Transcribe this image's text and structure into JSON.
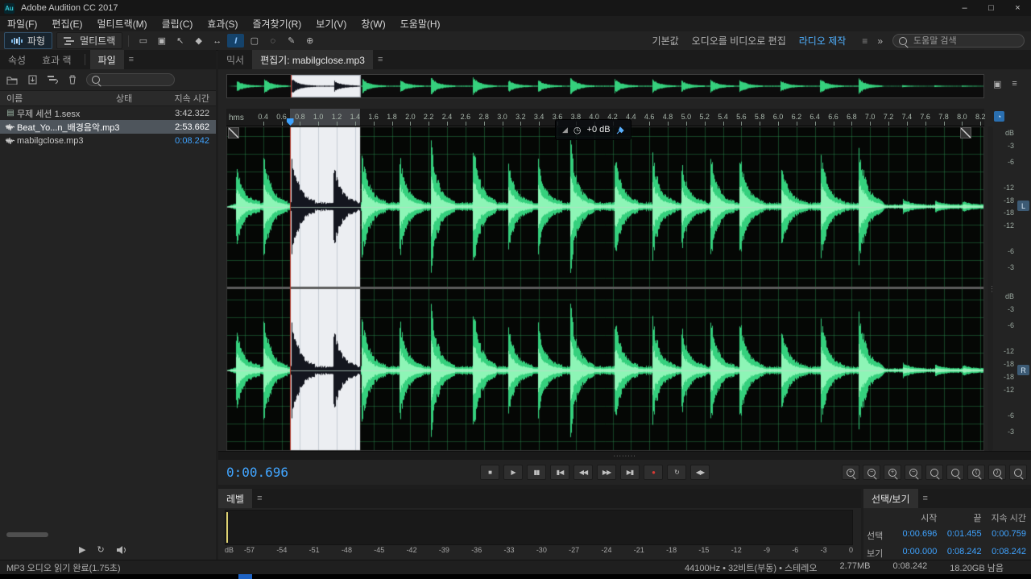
{
  "window": {
    "title": "Adobe Audition CC 2017",
    "icon_text": "Au",
    "minimize_glyph": "–",
    "maximize_glyph": "□",
    "close_glyph": "×"
  },
  "menu_bar": {
    "items": [
      "파일(F)",
      "편집(E)",
      "멀티트랙(M)",
      "클립(C)",
      "효과(S)",
      "즐겨찾기(R)",
      "보기(V)",
      "창(W)",
      "도움말(H)"
    ]
  },
  "toolbar": {
    "view_buttons": [
      {
        "name": "waveform-view-button",
        "label": "파형",
        "active": true
      },
      {
        "name": "multitrack-view-button",
        "label": "멀티트랙",
        "active": false
      }
    ],
    "tools": [
      {
        "name": "panel-layout-icon",
        "glyph": "▭",
        "active": false
      },
      {
        "name": "video-monitor-icon",
        "glyph": "▣",
        "active": false
      },
      {
        "name": "move-tool-icon",
        "glyph": "↖",
        "active": false
      },
      {
        "name": "razor-tool-icon",
        "glyph": "◆",
        "active": false
      },
      {
        "name": "slip-tool-icon",
        "glyph": "↔",
        "active": false
      },
      {
        "name": "time-selection-tool-icon",
        "glyph": "I",
        "active": true
      },
      {
        "name": "marquee-selection-tool-icon",
        "glyph": "▢",
        "active": false
      },
      {
        "name": "lasso-selection-tool-icon",
        "glyph": "◌",
        "active": false
      },
      {
        "name": "paintbrush-tool-icon",
        "glyph": "✎",
        "active": false
      },
      {
        "name": "spot-healing-brush-icon",
        "glyph": "⊕",
        "active": false
      }
    ],
    "workspaces": [
      {
        "label": "기본값",
        "active": false
      },
      {
        "label": "오디오를 비디오로 편집",
        "active": false
      },
      {
        "label": "라디오 제작",
        "active": true
      }
    ],
    "workspace_menu_glyph": "≡",
    "overflow_glyph": "»",
    "search": {
      "placeholder": "도움말 검색"
    }
  },
  "files_panel": {
    "tabs": [
      {
        "label": "속성",
        "active": false
      },
      {
        "label": "효과 랙",
        "active": false
      },
      {
        "label": "파일",
        "active": true
      }
    ],
    "panel_menu_glyph": "≡",
    "columns": [
      "이름",
      "상태",
      "지속 시간"
    ],
    "rows": [
      {
        "name": "무제 세션 1.sesx",
        "status": "",
        "duration": "3:42.322",
        "type": "session",
        "selected": false,
        "open": false
      },
      {
        "name": "Beat_Yo...n_배경음악.mp3",
        "status": "",
        "duration": "2:53.662",
        "type": "audio",
        "selected": true,
        "open": false
      },
      {
        "name": "mabilgclose.mp3",
        "status": "",
        "duration": "0:08.242",
        "type": "audio",
        "selected": false,
        "open": true
      }
    ]
  },
  "editor": {
    "tabs": [
      {
        "label": "믹서",
        "active": false
      },
      {
        "label": "편집기: mabilgclose.mp3",
        "active": true
      }
    ],
    "panel_menu_glyph": "≡",
    "timeline": {
      "unit": "hms",
      "ticks": [
        "0.4",
        "0.6",
        "0.8",
        "1.0",
        "1.2",
        "1.4",
        "1.6",
        "1.8",
        "2.0",
        "2.2",
        "2.4",
        "2.6",
        "2.8",
        "3.0",
        "3.2",
        "3.4",
        "3.6",
        "3.8",
        "4.0",
        "4.2",
        "4.4",
        "4.6",
        "4.8",
        "5.0",
        "5.2",
        "5.4",
        "5.6",
        "5.8",
        "6.0",
        "6.2",
        "6.4",
        "6.6",
        "6.8",
        "7.0",
        "7.2",
        "7.4",
        "7.6",
        "7.8",
        "8.0",
        "8.2"
      ],
      "view_start_seconds": 0,
      "view_end_seconds": 8.242
    },
    "selection": {
      "start_seconds": 0.696,
      "end_seconds": 1.455
    },
    "hud": {
      "gain_label": "+0 dB"
    },
    "amplitude_ruler": {
      "unit": "dB",
      "labels": [
        "-3",
        "-6",
        "-12",
        "-18"
      ]
    },
    "channel_buttons": [
      "L",
      "R"
    ],
    "colors": {
      "waveform": "#35d07d",
      "waveform_bright": "#8df5b6",
      "selection_bg": "#eceef2",
      "selection_wave": "#14161f",
      "playhead": "#c0392b",
      "grid": "rgba(40,130,70,0.5)"
    }
  },
  "transport": {
    "time": "0:00.696",
    "buttons": [
      {
        "name": "stop-button",
        "glyph": "■"
      },
      {
        "name": "play-button",
        "glyph": "▶"
      },
      {
        "name": "pause-button",
        "glyph": "▮▮"
      },
      {
        "name": "skip-to-start-button",
        "glyph": "▮◀"
      },
      {
        "name": "rewind-button",
        "glyph": "◀◀"
      },
      {
        "name": "fast-forward-button",
        "glyph": "▶▶"
      },
      {
        "name": "skip-to-end-button",
        "glyph": "▶▮"
      },
      {
        "name": "record-button",
        "glyph": "●",
        "color": "#d83a34"
      },
      {
        "name": "loop-playback-button",
        "glyph": "↻"
      },
      {
        "name": "skip-selection-button",
        "glyph": "◀▶"
      }
    ],
    "zoom_buttons": [
      {
        "name": "zoom-in-time-button",
        "sub": "+"
      },
      {
        "name": "zoom-out-time-button",
        "sub": "−"
      },
      {
        "name": "zoom-in-amplitude-button",
        "sub": "+"
      },
      {
        "name": "zoom-out-amplitude-button",
        "sub": "−"
      },
      {
        "name": "zoom-full-button",
        "sub": ""
      },
      {
        "name": "zoom-selection-button",
        "sub": ""
      },
      {
        "name": "zoom-selection-in-button",
        "sub": "⟨"
      },
      {
        "name": "zoom-selection-out-button",
        "sub": "⟩"
      },
      {
        "name": "zoom-reset-button",
        "sub": ""
      }
    ]
  },
  "levels_panel": {
    "tab_label": "레벨",
    "panel_menu_glyph": "≡",
    "unit": "dB",
    "scale": [
      "-57",
      "-54",
      "-51",
      "-48",
      "-45",
      "-42",
      "-39",
      "-36",
      "-33",
      "-30",
      "-27",
      "-24",
      "-21",
      "-18",
      "-15",
      "-12",
      "-9",
      "-6",
      "-3",
      "0"
    ]
  },
  "selection_view_panel": {
    "tab_label": "선택/보기",
    "panel_menu_glyph": "≡",
    "columns": [
      "시작",
      "끝",
      "지속 시간"
    ],
    "rows": [
      {
        "label": "선택",
        "start": "0:00.696",
        "end": "0:01.455",
        "duration": "0:00.759"
      },
      {
        "label": "보기",
        "start": "0:00.000",
        "end": "0:08.242",
        "duration": "0:08.242"
      }
    ]
  },
  "status_bar": {
    "left": "MP3 오디오 읽기 완료(1.75초)",
    "right_segments": [
      "44100Hz • 32비트(부동) • 스테레오",
      "2.77MB",
      "0:08.242",
      "18.20GB 남음"
    ]
  }
}
